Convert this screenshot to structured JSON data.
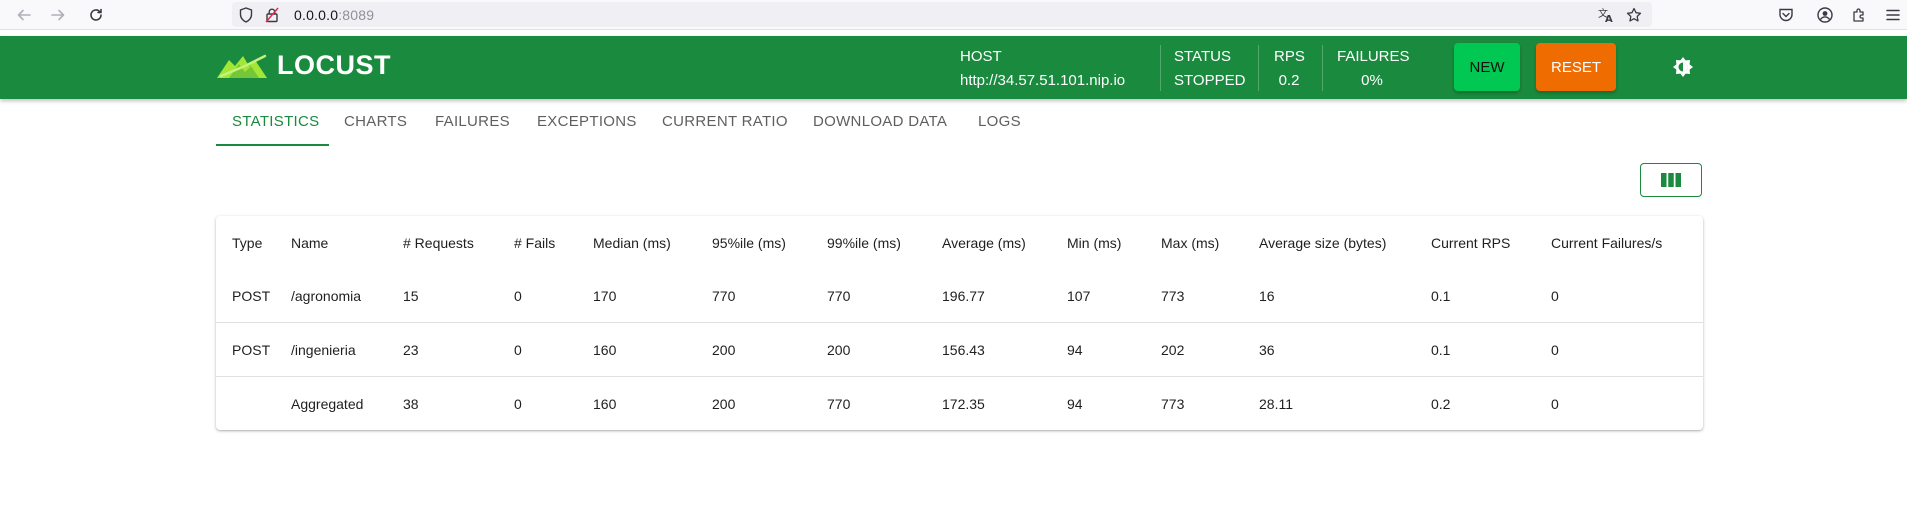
{
  "browser": {
    "url_host": "0.0.0.0",
    "url_port": ":8089"
  },
  "app": {
    "logo_text": "LOCUST",
    "host_label": "HOST",
    "host_value": "http://34.57.51.101.nip.io",
    "status_label": "STATUS",
    "status_value": "STOPPED",
    "rps_label": "RPS",
    "rps_value": "0.2",
    "failures_label": "FAILURES",
    "failures_value": "0%",
    "new_label": "NEW",
    "reset_label": "RESET",
    "colors": {
      "header": "#1a8b3e",
      "new": "#00c853",
      "reset": "#ef6c00"
    }
  },
  "tabs": [
    {
      "label": "STATISTICS",
      "active": true
    },
    {
      "label": "CHARTS"
    },
    {
      "label": "FAILURES"
    },
    {
      "label": "EXCEPTIONS"
    },
    {
      "label": "CURRENT RATIO"
    },
    {
      "label": "DOWNLOAD DATA"
    },
    {
      "label": "LOGS"
    }
  ],
  "table": {
    "headers": [
      "Type",
      "Name",
      "# Requests",
      "# Fails",
      "Median (ms)",
      "95%ile (ms)",
      "99%ile (ms)",
      "Average (ms)",
      "Min (ms)",
      "Max (ms)",
      "Average size (bytes)",
      "Current RPS",
      "Current Failures/s"
    ],
    "rows": [
      [
        "POST",
        "/agronomia",
        "15",
        "0",
        "170",
        "770",
        "770",
        "196.77",
        "107",
        "773",
        "16",
        "0.1",
        "0"
      ],
      [
        "POST",
        "/ingenieria",
        "23",
        "0",
        "160",
        "200",
        "200",
        "156.43",
        "94",
        "202",
        "36",
        "0.1",
        "0"
      ],
      [
        "",
        "Aggregated",
        "38",
        "0",
        "160",
        "200",
        "770",
        "172.35",
        "94",
        "773",
        "28.11",
        "0.2",
        "0"
      ]
    ]
  }
}
